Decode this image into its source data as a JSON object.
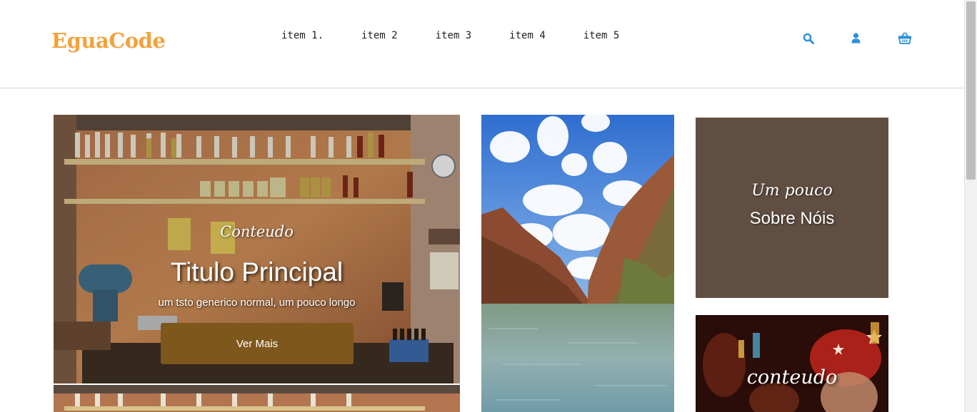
{
  "brand": {
    "logo_text": "EguaCode",
    "accent_color": "#f2a23c"
  },
  "nav": {
    "items": [
      {
        "label": "item 1."
      },
      {
        "label": "item 2"
      },
      {
        "label": "item 3"
      },
      {
        "label": "item 4"
      },
      {
        "label": "item 5"
      }
    ]
  },
  "header_icons": [
    {
      "icon": "search-icon"
    },
    {
      "icon": "user-icon"
    },
    {
      "icon": "basket-icon"
    }
  ],
  "colors": {
    "icon_blue": "#2a8fd6",
    "button_brown": "#7e571d",
    "about_bg": "#614e42"
  },
  "hero": {
    "subtitle": "Conteudo",
    "title": "Titulo Principal",
    "description": "um tsto generico normal, um pouco longo",
    "button_label": "Ver Mais"
  },
  "about_card": {
    "subtitle": "Um pouco",
    "title": "Sobre Nóis"
  },
  "second_card": {
    "label": "conteudo"
  }
}
